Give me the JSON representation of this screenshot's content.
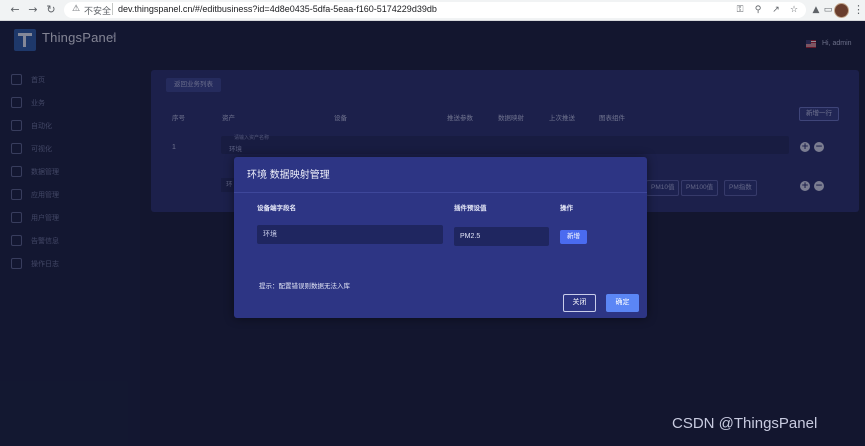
{
  "browser": {
    "security_label": "不安全",
    "url": "dev.thingspanel.cn/#/editbusiness?id=4d8e0435-5dfa-5eaa-f160-5174229d39db"
  },
  "sidebar": {
    "brand": "ThingsPanel",
    "items": [
      {
        "label": "首页",
        "icon": "home-icon"
      },
      {
        "label": "业务",
        "icon": "business-icon"
      },
      {
        "label": "自动化",
        "icon": "automation-icon"
      },
      {
        "label": "可视化",
        "icon": "visualization-icon"
      },
      {
        "label": "数据管理",
        "icon": "data-icon"
      },
      {
        "label": "应用管理",
        "icon": "app-icon"
      },
      {
        "label": "用户管理",
        "icon": "user-icon"
      },
      {
        "label": "告警信息",
        "icon": "alarm-icon"
      },
      {
        "label": "操作日志",
        "icon": "log-icon"
      }
    ]
  },
  "header": {
    "greeting": "Hi, admin"
  },
  "panel": {
    "back_button": "返回业务列表",
    "new_row_button": "新增一行",
    "columns": [
      "序号",
      "资产",
      "设备",
      "推送参数",
      "数据映射",
      "上次推送",
      "图表组件"
    ],
    "row1": {
      "index": "1",
      "asset_placeholder": "请输入资产名称",
      "asset_value": "环境"
    },
    "row2": {
      "asset_value": "环",
      "tags": [
        "PM10值",
        "PM100值",
        "PM指数"
      ]
    }
  },
  "modal": {
    "title": "环境 数据映射管理",
    "columns": {
      "device_field": "设备端字段名",
      "preset": "插件预设值",
      "action": "操作"
    },
    "device_field_value": "环境",
    "preset_value": "PM2.5",
    "add_button": "新增",
    "hint": "提示：配置错误则数据无法入库",
    "close_button": "关闭",
    "ok_button": "确定"
  },
  "watermark": "CSDN @ThingsPanel",
  "colors": {
    "sidebar_bg": "#1b2141",
    "main_bg": "#1a1f3d",
    "panel_bg": "#2a3270",
    "modal_bg": "#2d3584",
    "primary": "#5b86f5"
  }
}
